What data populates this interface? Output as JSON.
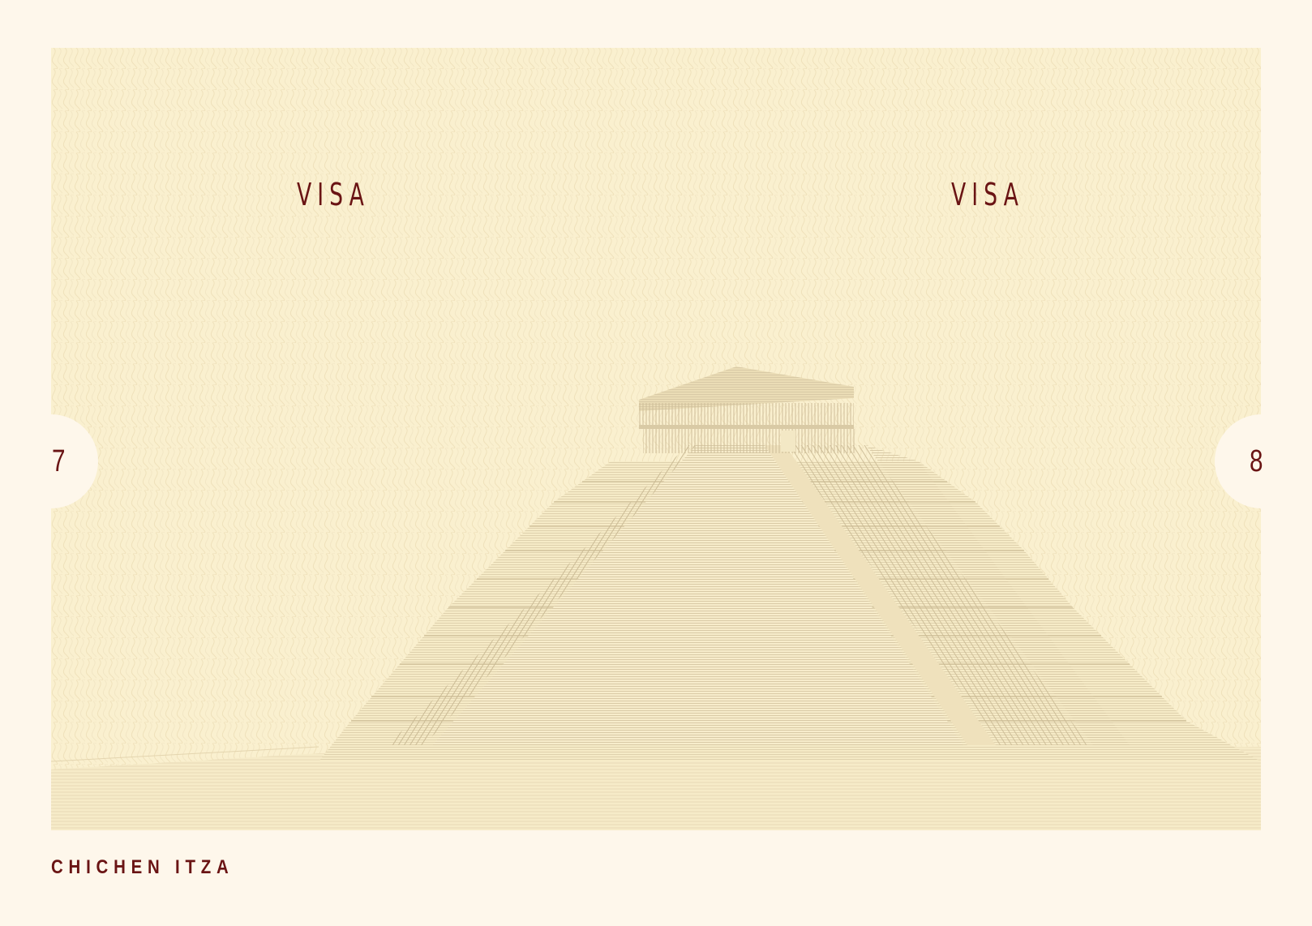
{
  "spread": {
    "left_page": {
      "heading": "VISA",
      "page_number": "7"
    },
    "right_page": {
      "heading": "VISA",
      "page_number": "8"
    },
    "footer_location": "CHICHEN ITZA"
  },
  "colors": {
    "paper": "#fef7eb",
    "panel": "#faf0cf",
    "ink": "#6a1414",
    "engraving": "#d8c9a4"
  },
  "illustration": "chichen-itza-pyramid-engraving"
}
